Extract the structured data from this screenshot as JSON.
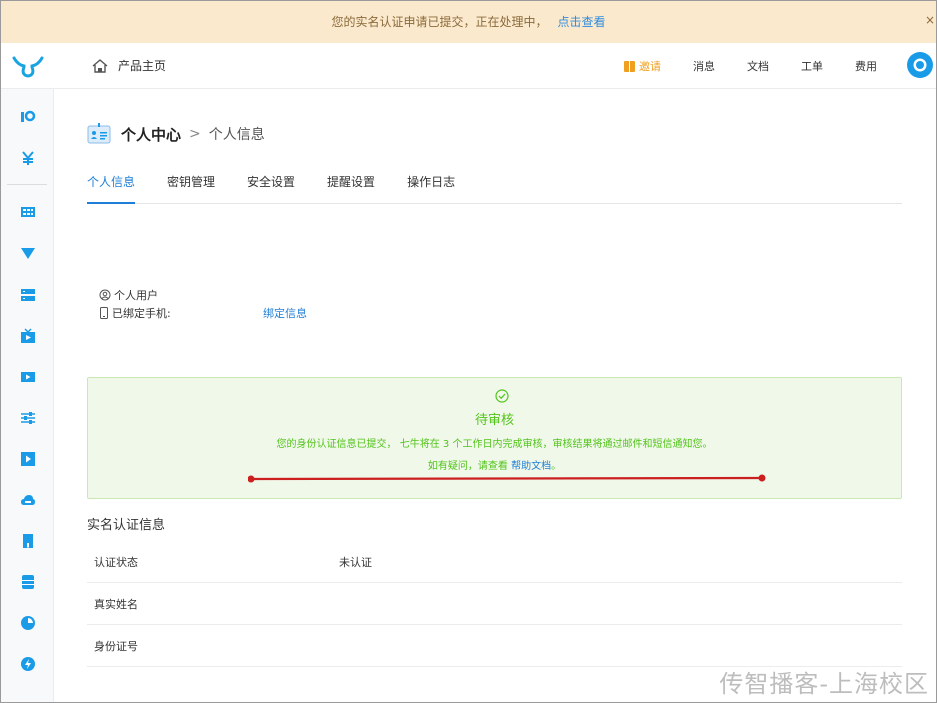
{
  "notice": {
    "message": "您的实名认证申请已提交，正在处理中，",
    "link": "点击查看",
    "close": "×"
  },
  "topbar": {
    "home_label": "产品主页",
    "nav": [
      {
        "label": "邀请"
      },
      {
        "label": "消息"
      },
      {
        "label": "文档"
      },
      {
        "label": "工单"
      },
      {
        "label": "费用"
      }
    ]
  },
  "breadcrumb": {
    "title": "个人中心",
    "separator": ">",
    "current": "个人信息"
  },
  "tabs": [
    {
      "label": "个人信息",
      "active": true
    },
    {
      "label": "密钥管理",
      "active": false
    },
    {
      "label": "安全设置",
      "active": false
    },
    {
      "label": "提醒设置",
      "active": false
    },
    {
      "label": "操作日志",
      "active": false
    }
  ],
  "profile": {
    "user_type": "个人用户",
    "phone_label": "已绑定手机:",
    "bind_link": "绑定信息"
  },
  "status_box": {
    "heading": "待审核",
    "description": "您的身份认证信息已提交， 七牛将在 3 个工作日内完成审核，审核结果将通过邮件和短信通知您。",
    "help_prefix": "如有疑问，请查看 ",
    "help_link": "帮助文档",
    "help_suffix": "。"
  },
  "verification": {
    "section_title": "实名认证信息",
    "rows": [
      {
        "label": "认证状态",
        "value": "未认证"
      },
      {
        "label": "真实姓名",
        "value": ""
      },
      {
        "label": "身份证号",
        "value": ""
      }
    ]
  },
  "watermark": "传智播客-上海校区",
  "colors": {
    "accent": "#1f7fd6",
    "success": "#52c41a",
    "notice_bg": "#fbe9cd",
    "annotation": "#cc1f1f"
  }
}
